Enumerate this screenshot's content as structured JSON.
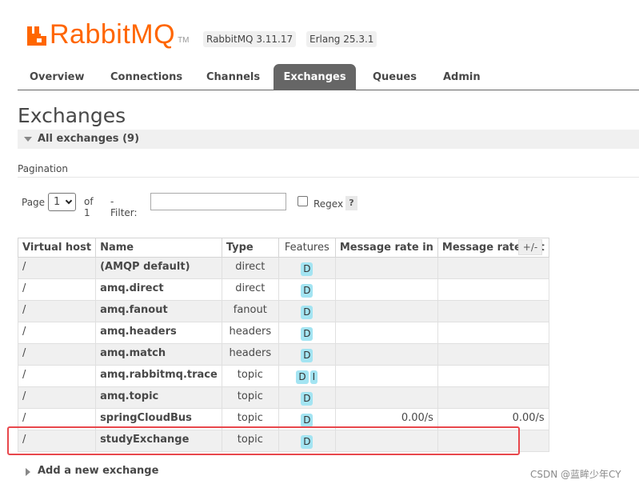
{
  "header": {
    "logo_text": "RabbitMQ",
    "logo_tm": "TM",
    "version_label": "RabbitMQ 3.11.17",
    "erlang_label": "Erlang 25.3.1"
  },
  "tabs": [
    {
      "label": "Overview",
      "active": false
    },
    {
      "label": "Connections",
      "active": false
    },
    {
      "label": "Channels",
      "active": false
    },
    {
      "label": "Exchanges",
      "active": true
    },
    {
      "label": "Queues",
      "active": false
    },
    {
      "label": "Admin",
      "active": false
    }
  ],
  "page_title": "Exchanges",
  "section_title": "All exchanges (9)",
  "pagination": {
    "label": "Pagination",
    "page_label": "Page",
    "page_value": "1",
    "of_label": "of 1",
    "filter_label": "- Filter:",
    "filter_value": "",
    "regex_label": "Regex",
    "regex_checked": false,
    "help_label": "?"
  },
  "table": {
    "columns": [
      "Virtual host",
      "Name",
      "Type",
      "Features",
      "Message rate in",
      "Message rate out"
    ],
    "toggle_label": "+/-",
    "rows": [
      {
        "vhost": "/",
        "name": "(AMQP default)",
        "type": "direct",
        "features": [
          "D"
        ],
        "rate_in": "",
        "rate_out": ""
      },
      {
        "vhost": "/",
        "name": "amq.direct",
        "type": "direct",
        "features": [
          "D"
        ],
        "rate_in": "",
        "rate_out": ""
      },
      {
        "vhost": "/",
        "name": "amq.fanout",
        "type": "fanout",
        "features": [
          "D"
        ],
        "rate_in": "",
        "rate_out": ""
      },
      {
        "vhost": "/",
        "name": "amq.headers",
        "type": "headers",
        "features": [
          "D"
        ],
        "rate_in": "",
        "rate_out": ""
      },
      {
        "vhost": "/",
        "name": "amq.match",
        "type": "headers",
        "features": [
          "D"
        ],
        "rate_in": "",
        "rate_out": ""
      },
      {
        "vhost": "/",
        "name": "amq.rabbitmq.trace",
        "type": "topic",
        "features": [
          "D",
          "I"
        ],
        "rate_in": "",
        "rate_out": ""
      },
      {
        "vhost": "/",
        "name": "amq.topic",
        "type": "topic",
        "features": [
          "D"
        ],
        "rate_in": "",
        "rate_out": ""
      },
      {
        "vhost": "/",
        "name": "springCloudBus",
        "type": "topic",
        "features": [
          "D"
        ],
        "rate_in": "0.00/s",
        "rate_out": "0.00/s"
      },
      {
        "vhost": "/",
        "name": "studyExchange",
        "type": "topic",
        "features": [
          "D"
        ],
        "rate_in": "",
        "rate_out": "",
        "highlighted": true
      }
    ]
  },
  "add_new_label": "Add a new exchange",
  "watermark": "CSDN @蓝眸少年CY",
  "colors": {
    "brand_orange": "#ff6600",
    "active_tab": "#666666",
    "feature_badge": "#a3e4f2",
    "highlight_border": "#e8474c"
  }
}
